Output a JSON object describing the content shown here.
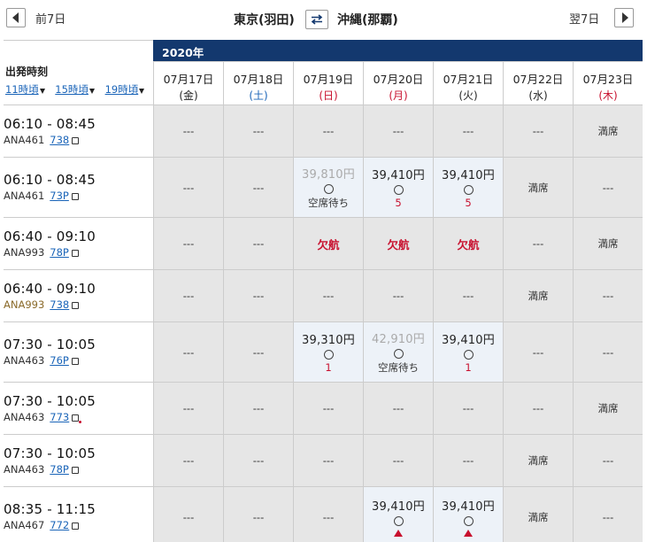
{
  "nav": {
    "prev_label": "前7日",
    "next_label": "翌7日",
    "origin": "東京(羽田)",
    "destination": "沖縄(那覇)"
  },
  "header": {
    "year": "2020年",
    "title": "出発時刻",
    "sort_links": [
      "11時頃",
      "15時頃",
      "19時頃"
    ]
  },
  "dates": [
    {
      "date": "07月17日",
      "weekday": "(金)",
      "type": "weekday"
    },
    {
      "date": "07月18日",
      "weekday": "(土)",
      "type": "sat"
    },
    {
      "date": "07月19日",
      "weekday": "(日)",
      "type": "sun"
    },
    {
      "date": "07月20日",
      "weekday": "(月)",
      "type": "holi"
    },
    {
      "date": "07月21日",
      "weekday": "(火)",
      "type": "weekday"
    },
    {
      "date": "07月22日",
      "weekday": "(水)",
      "type": "weekday"
    },
    {
      "date": "07月23日",
      "weekday": "(木)",
      "type": "holi"
    }
  ],
  "flights": [
    {
      "time": "06:10 - 08:45",
      "flight": "ANA461",
      "aircraft": "738",
      "alt": false,
      "seat_red": false,
      "cells": [
        {
          "t": "none",
          "label": "---"
        },
        {
          "t": "none",
          "label": "---"
        },
        {
          "t": "none",
          "label": "---"
        },
        {
          "t": "none",
          "label": "---"
        },
        {
          "t": "none",
          "label": "---"
        },
        {
          "t": "none",
          "label": "---"
        },
        {
          "t": "full",
          "label": "満席"
        }
      ]
    },
    {
      "time": "06:10 - 08:45",
      "flight": "ANA461",
      "aircraft": "73P",
      "alt": false,
      "seat_red": false,
      "cells": [
        {
          "t": "none",
          "label": "---"
        },
        {
          "t": "none",
          "label": "---"
        },
        {
          "t": "wait",
          "price": "39,810円",
          "label": "空席待ち"
        },
        {
          "t": "avail",
          "price": "39,410円",
          "count": "5"
        },
        {
          "t": "avail",
          "price": "39,410円",
          "count": "5"
        },
        {
          "t": "full",
          "label": "満席"
        },
        {
          "t": "none",
          "label": "---"
        }
      ]
    },
    {
      "time": "06:40 - 09:10",
      "flight": "ANA993",
      "aircraft": "78P",
      "alt": false,
      "seat_red": false,
      "cells": [
        {
          "t": "none",
          "label": "---"
        },
        {
          "t": "none",
          "label": "---"
        },
        {
          "t": "cancel",
          "label": "欠航"
        },
        {
          "t": "cancel",
          "label": "欠航"
        },
        {
          "t": "cancel",
          "label": "欠航"
        },
        {
          "t": "none",
          "label": "---"
        },
        {
          "t": "full",
          "label": "満席"
        }
      ]
    },
    {
      "time": "06:40 - 09:10",
      "flight": "ANA993",
      "aircraft": "738",
      "alt": true,
      "seat_red": false,
      "cells": [
        {
          "t": "none",
          "label": "---"
        },
        {
          "t": "none",
          "label": "---"
        },
        {
          "t": "none",
          "label": "---"
        },
        {
          "t": "none",
          "label": "---"
        },
        {
          "t": "none",
          "label": "---"
        },
        {
          "t": "full",
          "label": "満席"
        },
        {
          "t": "none",
          "label": "---"
        }
      ]
    },
    {
      "time": "07:30 - 10:05",
      "flight": "ANA463",
      "aircraft": "76P",
      "alt": false,
      "seat_red": false,
      "cells": [
        {
          "t": "none",
          "label": "---"
        },
        {
          "t": "none",
          "label": "---"
        },
        {
          "t": "avail",
          "price": "39,310円",
          "count": "1"
        },
        {
          "t": "wait",
          "price": "42,910円",
          "label": "空席待ち"
        },
        {
          "t": "avail",
          "price": "39,410円",
          "count": "1"
        },
        {
          "t": "none",
          "label": "---"
        },
        {
          "t": "none",
          "label": "---"
        }
      ]
    },
    {
      "time": "07:30 - 10:05",
      "flight": "ANA463",
      "aircraft": "773",
      "alt": false,
      "seat_red": true,
      "cells": [
        {
          "t": "none",
          "label": "---"
        },
        {
          "t": "none",
          "label": "---"
        },
        {
          "t": "none",
          "label": "---"
        },
        {
          "t": "none",
          "label": "---"
        },
        {
          "t": "none",
          "label": "---"
        },
        {
          "t": "none",
          "label": "---"
        },
        {
          "t": "full",
          "label": "満席"
        }
      ]
    },
    {
      "time": "07:30 - 10:05",
      "flight": "ANA463",
      "aircraft": "78P",
      "alt": false,
      "seat_red": false,
      "cells": [
        {
          "t": "none",
          "label": "---"
        },
        {
          "t": "none",
          "label": "---"
        },
        {
          "t": "none",
          "label": "---"
        },
        {
          "t": "none",
          "label": "---"
        },
        {
          "t": "none",
          "label": "---"
        },
        {
          "t": "full",
          "label": "満席"
        },
        {
          "t": "none",
          "label": "---"
        }
      ]
    },
    {
      "time": "08:35 - 11:15",
      "flight": "ANA467",
      "aircraft": "772",
      "alt": false,
      "seat_red": false,
      "cells": [
        {
          "t": "none",
          "label": "---"
        },
        {
          "t": "none",
          "label": "---"
        },
        {
          "t": "none",
          "label": "---"
        },
        {
          "t": "warn",
          "price": "39,410円"
        },
        {
          "t": "warn",
          "price": "39,410円"
        },
        {
          "t": "full",
          "label": "満席"
        },
        {
          "t": "none",
          "label": "---"
        }
      ]
    }
  ]
}
